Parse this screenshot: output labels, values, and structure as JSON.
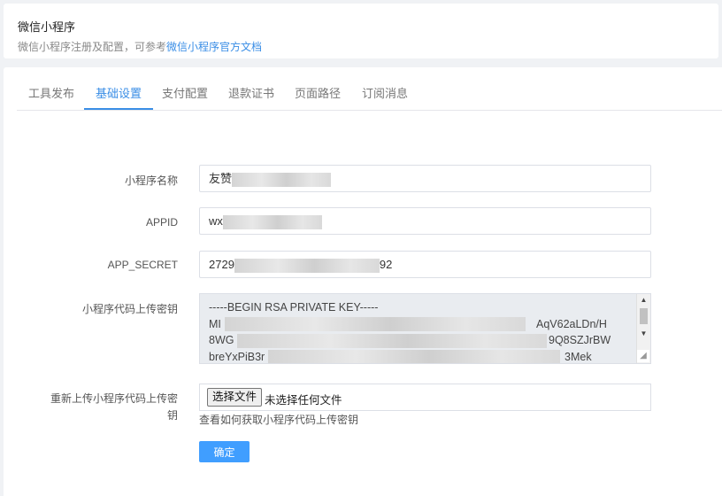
{
  "header": {
    "title": "微信小程序",
    "desc_prefix": "微信小程序注册及配置，可参考",
    "desc_link": "微信小程序官方文档"
  },
  "tabs": [
    {
      "label": "工具发布",
      "active": false
    },
    {
      "label": "基础设置",
      "active": true
    },
    {
      "label": "支付配置",
      "active": false
    },
    {
      "label": "退款证书",
      "active": false
    },
    {
      "label": "页面路径",
      "active": false
    },
    {
      "label": "订阅消息",
      "active": false
    }
  ],
  "form": {
    "name_label": "小程序名称",
    "name_value_visible": "友赞",
    "appid_label": "APPID",
    "appid_value_visible": "wx",
    "secret_label": "APP_SECRET",
    "secret_prefix": "2729",
    "secret_suffix": "92",
    "key_label": "小程序代码上传密钥",
    "key_lines": [
      {
        "left": "-----BEGIN RSA PRIVATE KEY-----",
        "right": ""
      },
      {
        "left": "MI",
        "right": "AqV62aLDn/H"
      },
      {
        "left": "8WG",
        "right": "9Q8SZJrBW"
      },
      {
        "left": "breYxPiB3r",
        "right": "3Mek"
      }
    ],
    "reupload_label": "重新上传小程序代码上传密钥",
    "file_button": "选择文件",
    "file_status": "未选择任何文件",
    "help_link": "查看如何获取小程序代码上传密钥",
    "confirm": "确定"
  },
  "colors": {
    "accent": "#3a8ee6",
    "primary_button": "#409eff",
    "background": "#f0f2f5"
  }
}
